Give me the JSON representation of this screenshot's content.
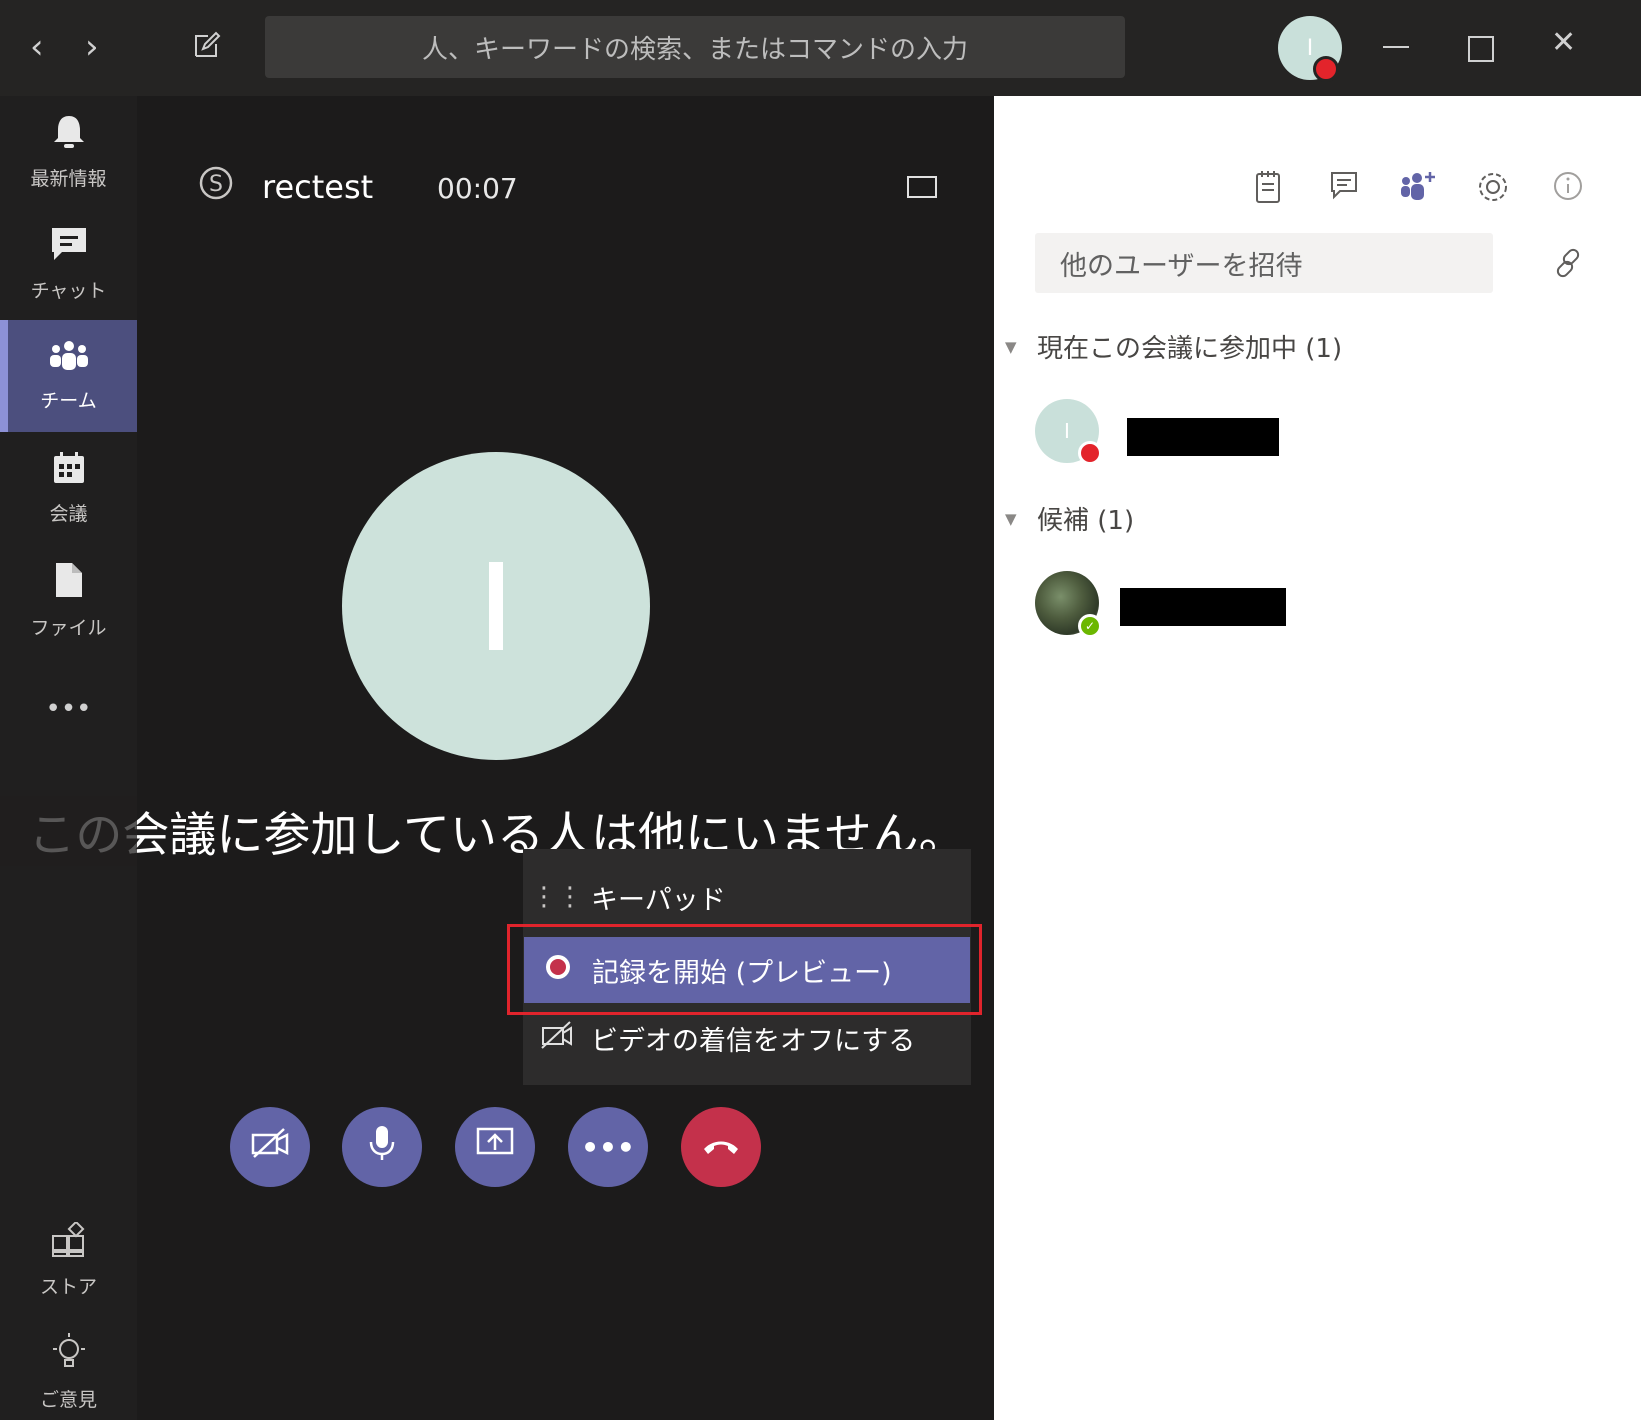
{
  "titlebar": {
    "search_placeholder": "人、キーワードの検索、またはコマンドの入力",
    "avatar_initial": "I"
  },
  "sidebar": {
    "items": [
      {
        "label": "最新情報",
        "icon": "bell-icon"
      },
      {
        "label": "チャット",
        "icon": "chat-icon"
      },
      {
        "label": "チーム",
        "icon": "teams-icon"
      },
      {
        "label": "会議",
        "icon": "calendar-icon"
      },
      {
        "label": "ファイル",
        "icon": "file-icon"
      }
    ],
    "more": "•••",
    "bottom": [
      {
        "label": "ストア",
        "icon": "store-icon"
      },
      {
        "label": "ご意見",
        "icon": "lightbulb-icon"
      }
    ]
  },
  "call": {
    "title": "rectest",
    "timer": "00:07",
    "avatar_initial": "I",
    "message": "この会議に参加している人は他にいません。",
    "menu": {
      "keypad": "キーパッド",
      "record": "記録を開始 (プレビュー)",
      "video_off": "ビデオの着信をオフにする"
    }
  },
  "panel": {
    "invite_placeholder": "他のユーザーを招待",
    "current_header": "現在この会議に参加中 (1)",
    "suggested_header": "候補 (1)",
    "participant_initial": "I"
  },
  "colors": {
    "accent": "#6264a7",
    "hangup": "#c4314b",
    "highlight": "#e0242c",
    "status_red": "#e3242b",
    "status_green": "#6bb700"
  }
}
